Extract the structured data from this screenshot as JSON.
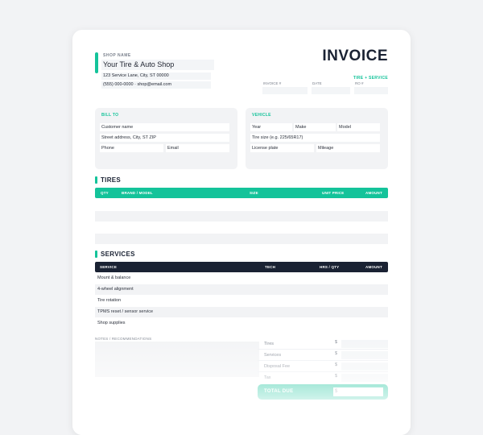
{
  "shop": {
    "label": "SHOP NAME",
    "name": "Your Tire & Auto Shop",
    "address": "123 Service Lane, City, ST 00000",
    "contact": "(555) 000-0000 · shop@email.com"
  },
  "invoice": {
    "title": "INVOICE",
    "subtitle": "TIRE + SERVICE",
    "meta_labels": [
      "INVOICE #",
      "DATE",
      "RO #"
    ]
  },
  "bill_to": {
    "title": "BILL TO",
    "customer_name": "Customer name",
    "street": "Street address, City, ST ZIP",
    "phone": "Phone",
    "email": "Email"
  },
  "vehicle": {
    "title": "VEHICLE",
    "year": "Year",
    "make": "Make",
    "model": "Model",
    "tire_size": "Tire size (e.g. 225/65R17)",
    "plate": "License plate",
    "mileage": "Mileage"
  },
  "tires": {
    "title": "TIRES",
    "headers": {
      "qty": "QTY",
      "brand": "BRAND / MODEL",
      "size": "SIZE",
      "unit_price": "UNIT PRICE",
      "amount": "AMOUNT"
    }
  },
  "services": {
    "title": "SERVICES",
    "headers": {
      "service": "SERVICE",
      "tech": "TECH",
      "hrs_qty": "HRS / QTY",
      "amount": "AMOUNT"
    },
    "rows": [
      "Mount & balance",
      "4-wheel alignment",
      "Tire rotation",
      "TPMS reset / sensor service",
      "Shop supplies"
    ]
  },
  "notes": {
    "label": "NOTES / RECOMMENDATIONS"
  },
  "totals": {
    "tires": "Tires",
    "services": "Services",
    "disposal": "Disposal Fee",
    "tax": "Tax",
    "currency": "$",
    "total_due": "TOTAL DUE"
  },
  "colors": {
    "accent": "#14c39a",
    "dark_header": "#1a2233"
  }
}
